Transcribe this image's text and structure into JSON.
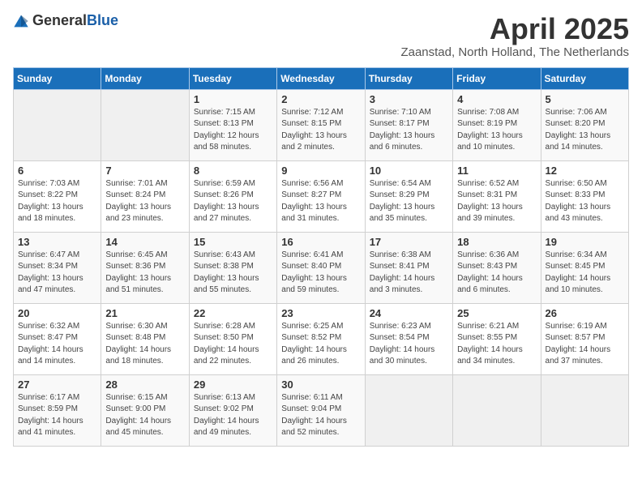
{
  "header": {
    "logo_general": "General",
    "logo_blue": "Blue",
    "month": "April 2025",
    "location": "Zaanstad, North Holland, The Netherlands"
  },
  "weekdays": [
    "Sunday",
    "Monday",
    "Tuesday",
    "Wednesday",
    "Thursday",
    "Friday",
    "Saturday"
  ],
  "weeks": [
    [
      {
        "day": "",
        "info": ""
      },
      {
        "day": "",
        "info": ""
      },
      {
        "day": "1",
        "info": "Sunrise: 7:15 AM\nSunset: 8:13 PM\nDaylight: 12 hours\nand 58 minutes."
      },
      {
        "day": "2",
        "info": "Sunrise: 7:12 AM\nSunset: 8:15 PM\nDaylight: 13 hours\nand 2 minutes."
      },
      {
        "day": "3",
        "info": "Sunrise: 7:10 AM\nSunset: 8:17 PM\nDaylight: 13 hours\nand 6 minutes."
      },
      {
        "day": "4",
        "info": "Sunrise: 7:08 AM\nSunset: 8:19 PM\nDaylight: 13 hours\nand 10 minutes."
      },
      {
        "day": "5",
        "info": "Sunrise: 7:06 AM\nSunset: 8:20 PM\nDaylight: 13 hours\nand 14 minutes."
      }
    ],
    [
      {
        "day": "6",
        "info": "Sunrise: 7:03 AM\nSunset: 8:22 PM\nDaylight: 13 hours\nand 18 minutes."
      },
      {
        "day": "7",
        "info": "Sunrise: 7:01 AM\nSunset: 8:24 PM\nDaylight: 13 hours\nand 23 minutes."
      },
      {
        "day": "8",
        "info": "Sunrise: 6:59 AM\nSunset: 8:26 PM\nDaylight: 13 hours\nand 27 minutes."
      },
      {
        "day": "9",
        "info": "Sunrise: 6:56 AM\nSunset: 8:27 PM\nDaylight: 13 hours\nand 31 minutes."
      },
      {
        "day": "10",
        "info": "Sunrise: 6:54 AM\nSunset: 8:29 PM\nDaylight: 13 hours\nand 35 minutes."
      },
      {
        "day": "11",
        "info": "Sunrise: 6:52 AM\nSunset: 8:31 PM\nDaylight: 13 hours\nand 39 minutes."
      },
      {
        "day": "12",
        "info": "Sunrise: 6:50 AM\nSunset: 8:33 PM\nDaylight: 13 hours\nand 43 minutes."
      }
    ],
    [
      {
        "day": "13",
        "info": "Sunrise: 6:47 AM\nSunset: 8:34 PM\nDaylight: 13 hours\nand 47 minutes."
      },
      {
        "day": "14",
        "info": "Sunrise: 6:45 AM\nSunset: 8:36 PM\nDaylight: 13 hours\nand 51 minutes."
      },
      {
        "day": "15",
        "info": "Sunrise: 6:43 AM\nSunset: 8:38 PM\nDaylight: 13 hours\nand 55 minutes."
      },
      {
        "day": "16",
        "info": "Sunrise: 6:41 AM\nSunset: 8:40 PM\nDaylight: 13 hours\nand 59 minutes."
      },
      {
        "day": "17",
        "info": "Sunrise: 6:38 AM\nSunset: 8:41 PM\nDaylight: 14 hours\nand 3 minutes."
      },
      {
        "day": "18",
        "info": "Sunrise: 6:36 AM\nSunset: 8:43 PM\nDaylight: 14 hours\nand 6 minutes."
      },
      {
        "day": "19",
        "info": "Sunrise: 6:34 AM\nSunset: 8:45 PM\nDaylight: 14 hours\nand 10 minutes."
      }
    ],
    [
      {
        "day": "20",
        "info": "Sunrise: 6:32 AM\nSunset: 8:47 PM\nDaylight: 14 hours\nand 14 minutes."
      },
      {
        "day": "21",
        "info": "Sunrise: 6:30 AM\nSunset: 8:48 PM\nDaylight: 14 hours\nand 18 minutes."
      },
      {
        "day": "22",
        "info": "Sunrise: 6:28 AM\nSunset: 8:50 PM\nDaylight: 14 hours\nand 22 minutes."
      },
      {
        "day": "23",
        "info": "Sunrise: 6:25 AM\nSunset: 8:52 PM\nDaylight: 14 hours\nand 26 minutes."
      },
      {
        "day": "24",
        "info": "Sunrise: 6:23 AM\nSunset: 8:54 PM\nDaylight: 14 hours\nand 30 minutes."
      },
      {
        "day": "25",
        "info": "Sunrise: 6:21 AM\nSunset: 8:55 PM\nDaylight: 14 hours\nand 34 minutes."
      },
      {
        "day": "26",
        "info": "Sunrise: 6:19 AM\nSunset: 8:57 PM\nDaylight: 14 hours\nand 37 minutes."
      }
    ],
    [
      {
        "day": "27",
        "info": "Sunrise: 6:17 AM\nSunset: 8:59 PM\nDaylight: 14 hours\nand 41 minutes."
      },
      {
        "day": "28",
        "info": "Sunrise: 6:15 AM\nSunset: 9:00 PM\nDaylight: 14 hours\nand 45 minutes."
      },
      {
        "day": "29",
        "info": "Sunrise: 6:13 AM\nSunset: 9:02 PM\nDaylight: 14 hours\nand 49 minutes."
      },
      {
        "day": "30",
        "info": "Sunrise: 6:11 AM\nSunset: 9:04 PM\nDaylight: 14 hours\nand 52 minutes."
      },
      {
        "day": "",
        "info": ""
      },
      {
        "day": "",
        "info": ""
      },
      {
        "day": "",
        "info": ""
      }
    ]
  ]
}
